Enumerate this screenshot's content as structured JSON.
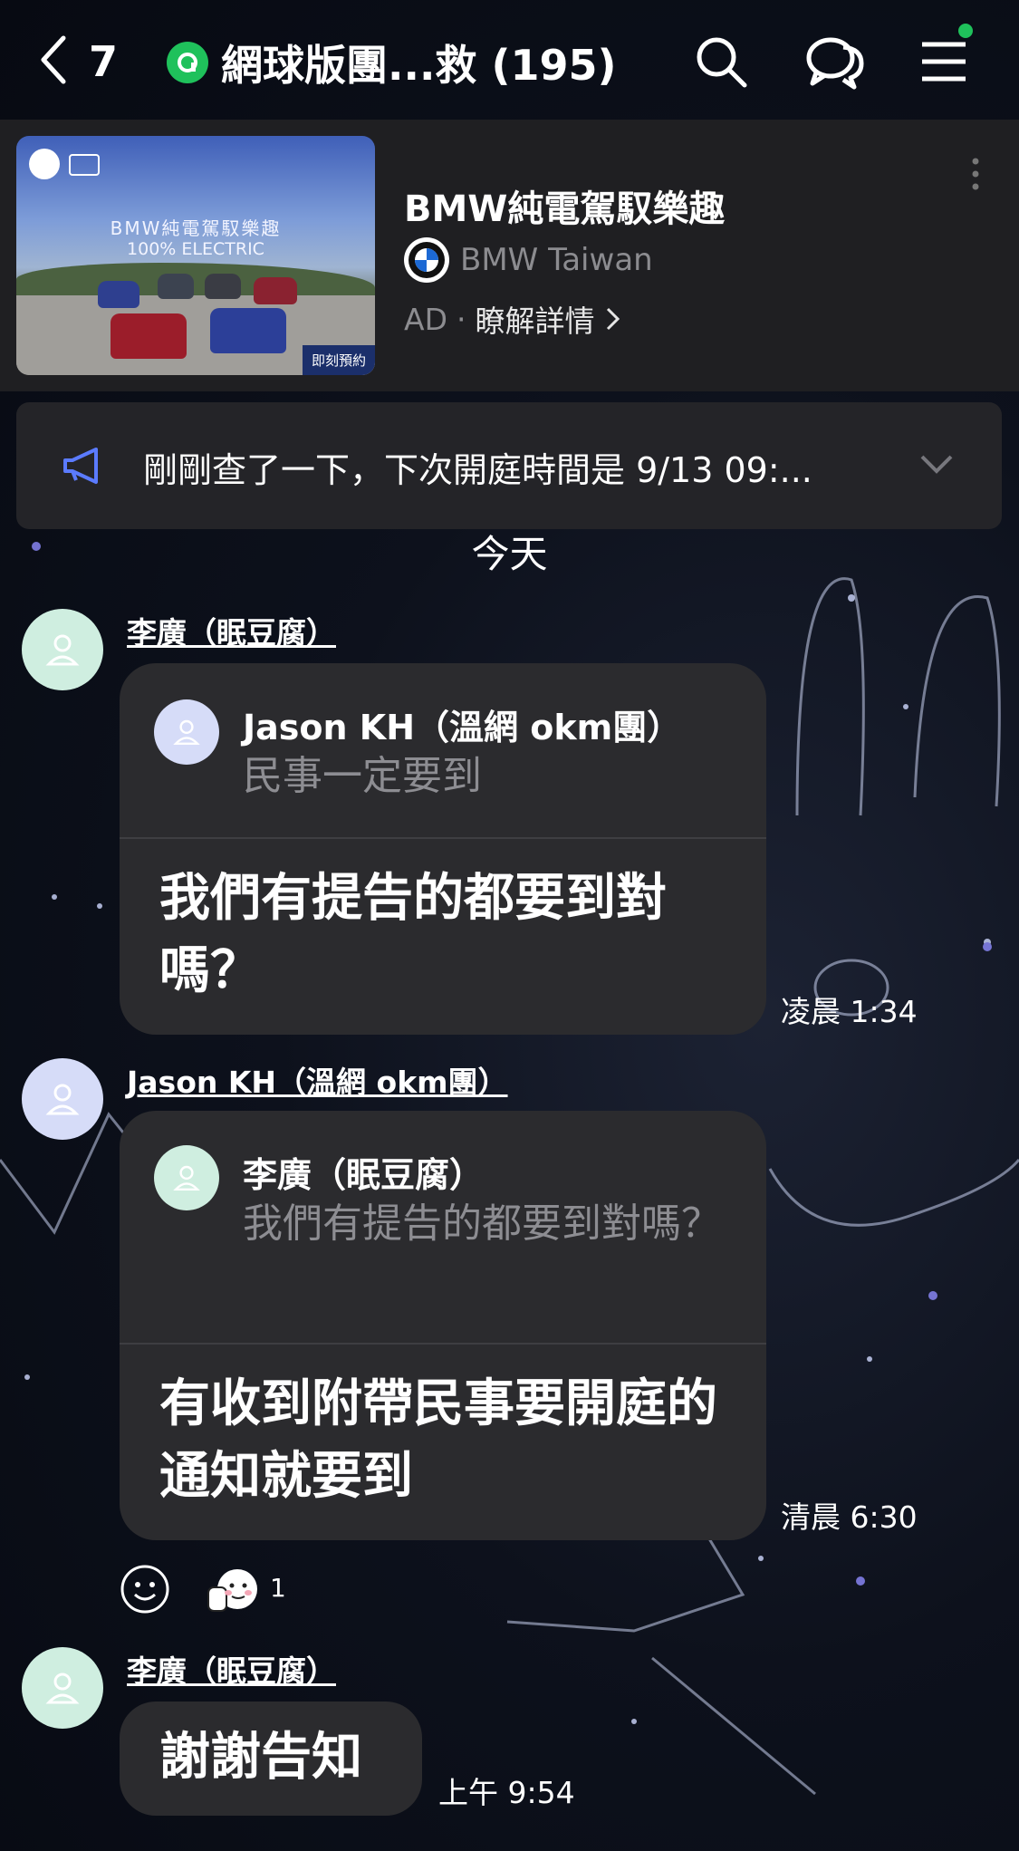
{
  "header": {
    "back_count": "7",
    "chat_title": "網球版團...救 (195)",
    "icons": [
      "back-chevron-icon",
      "openchat-icon",
      "search-icon",
      "chat-bubbles-icon",
      "menu-icon"
    ],
    "notification_dot_color": "#1fc15b"
  },
  "ad": {
    "image_headline": "BMW純電駕馭樂趣",
    "image_subline": "100% ELECTRIC",
    "image_cta": "即刻預約",
    "title": "BMW純電駕馭樂趣",
    "advertiser": "BMW Taiwan",
    "ad_label": "AD",
    "separator": "·",
    "more_link": "瞭解詳情"
  },
  "announcement": {
    "text": "剛剛查了一下，下次開庭時間是 9/13 09:..."
  },
  "date_separator": "今天",
  "messages": [
    {
      "sender": "李廣（眠豆腐）",
      "reply_to_name": "Jason KH（溫網 okm團）",
      "reply_to_text": "民事一定要到",
      "text": "我們有提告的都要到對嗎？",
      "time": "凌晨 1:34"
    },
    {
      "sender": "Jason KH（溫網 okm團）",
      "reply_to_name": "李廣（眠豆腐）",
      "reply_to_text": "我們有提告的都要到對嗎？",
      "text": "有收到附帶民事要開庭的通知就要到",
      "time": "清晨 6:30",
      "reaction_count": "1"
    },
    {
      "sender": "李廣（眠豆腐）",
      "text": "謝謝告知",
      "time": "上午 9:54"
    }
  ]
}
